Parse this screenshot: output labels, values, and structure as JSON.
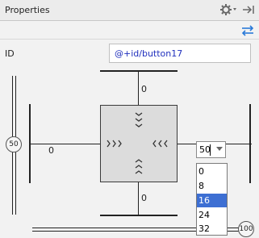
{
  "header": {
    "title": "Properties",
    "gear_icon": "gear-icon",
    "pin_icon": "pin-icon"
  },
  "toolbar": {
    "swap_icon": "swap-icon",
    "accent": "#2a7ad8"
  },
  "id_field": {
    "label": "ID",
    "value": "@+id/button17"
  },
  "constraints": {
    "top_margin": "0",
    "bottom_margin": "0",
    "left_margin": "0",
    "bias_vertical": "50",
    "bias_horizontal": "100"
  },
  "margin_select": {
    "value": "50",
    "options": [
      "0",
      "8",
      "16",
      "24",
      "32"
    ],
    "highlighted": "16",
    "highlight_color": "#3d6fd3"
  }
}
